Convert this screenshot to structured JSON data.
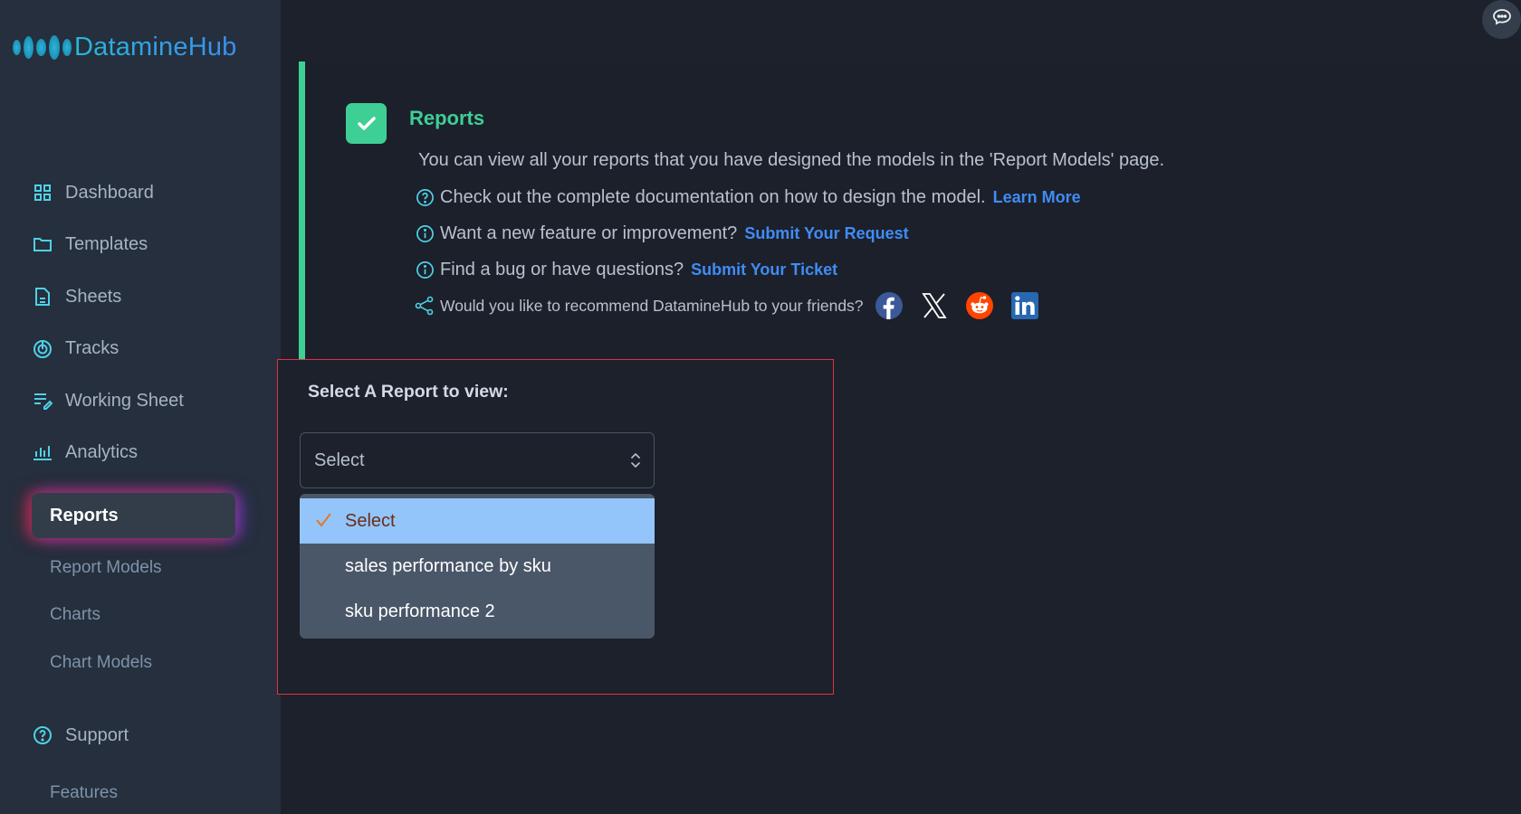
{
  "app": {
    "name": "DatamineHub"
  },
  "sidebar": {
    "items": [
      {
        "label": "Dashboard",
        "icon": "grid-icon"
      },
      {
        "label": "Templates",
        "icon": "folder-icon"
      },
      {
        "label": "Sheets",
        "icon": "document-icon"
      },
      {
        "label": "Tracks",
        "icon": "target-icon"
      },
      {
        "label": "Working Sheet",
        "icon": "edit-list-icon"
      },
      {
        "label": "Analytics",
        "icon": "bar-chart-icon"
      }
    ],
    "active": "Reports",
    "subitems": [
      "Report Models",
      "Charts",
      "Chart Models"
    ],
    "support": {
      "label": "Support",
      "icon": "help-circle-icon"
    },
    "features": "Features"
  },
  "info": {
    "title": "Reports",
    "description": "You can view all your reports that you have designed the models in the 'Report Models' page.",
    "docs_text": "Check out the complete documentation on how to design the model.",
    "docs_link": "Learn More",
    "feature_text": "Want a new feature or improvement?",
    "feature_link": "Submit Your Request",
    "bug_text": "Find a bug or have questions?",
    "bug_link": "Submit Your Ticket",
    "share_text": "Would you like to recommend DatamineHub to your friends?",
    "social": [
      "facebook",
      "x",
      "reddit",
      "linkedin"
    ]
  },
  "report_select": {
    "label": "Select A Report to view:",
    "value": "Select",
    "options": [
      "Select",
      "sales performance by sku",
      "sku performance 2"
    ],
    "selected_index": 0
  },
  "colors": {
    "accent_green": "#3ecf95",
    "link_blue": "#3f8cf5",
    "icon_cyan": "#4fd1e6",
    "highlight_option": "#93c5fb",
    "panel_border": "#e0323f"
  }
}
